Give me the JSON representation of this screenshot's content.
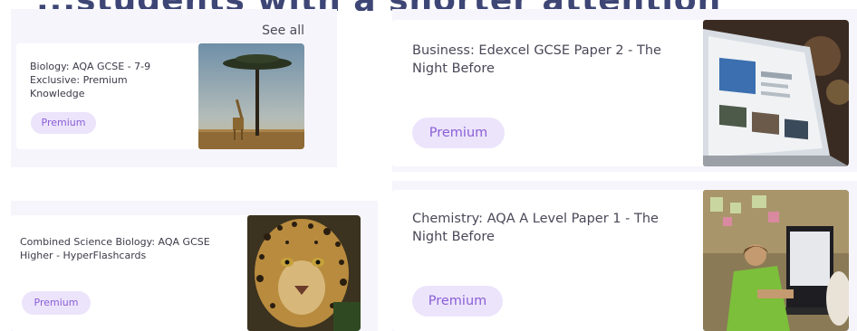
{
  "section": {
    "heading": "...students with a shorter attention",
    "see_all_label": "See all"
  },
  "cards": [
    {
      "title": "Biology: AQA GCSE - 7-9 Exclusive: Premium Knowledge",
      "badge": "Premium",
      "image": "giraffe-savanna-image"
    },
    {
      "title": "Combined Science Biology: AQA GCSE Higher - HyperFlashcards",
      "badge": "Premium",
      "image": "leopard-image"
    },
    {
      "title": "Business: Edexcel GCSE Paper 2 - The Night Before",
      "badge": "Premium",
      "image": "laptop-news-image"
    },
    {
      "title": "Chemistry: AQA A Level Paper 1 - The Night Before",
      "badge": "Premium",
      "image": "students-classroom-image"
    }
  ],
  "colors": {
    "badge_bg": "#ece4fb",
    "badge_text": "#8a5fd6",
    "panel_bg": "#f7f5fc",
    "heading": "#3d4675"
  }
}
